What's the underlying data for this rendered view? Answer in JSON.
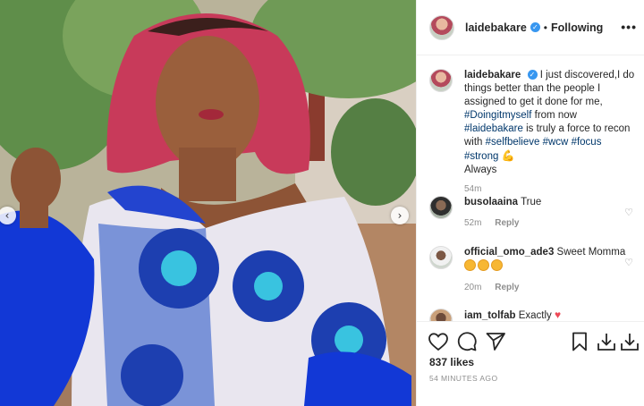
{
  "post": {
    "username": "laidebakare",
    "follow_status": "Following",
    "separator": "•",
    "more_label": "•••",
    "likes": "837 likes",
    "posted_ago": "54 MINUTES AGO"
  },
  "caption": {
    "username": "laidebakare",
    "text_1": "I just discovered,I do things better than the people I assigned to get it done for me,",
    "tag_1": "#Doingitmyself",
    "text_2": "from now",
    "tag_2": "#laidebakare",
    "text_3": "is truly a force to recon with",
    "tag_3": "#selfbelieve",
    "tag_4": "#wcw",
    "tag_5": "#focus",
    "tag_6": "#strong",
    "text_4": "Always",
    "time": "54m"
  },
  "comments": [
    {
      "username": "busolaaina",
      "text": "True",
      "time": "52m",
      "reply": "Reply"
    },
    {
      "username": "official_omo_ade3",
      "text": "Sweet Momma",
      "time": "20m",
      "reply": "Reply"
    },
    {
      "username": "iam_tolfab",
      "text": "Exactly"
    }
  ],
  "icons": {
    "like": "heart-icon",
    "comment": "comment-icon",
    "share": "share-icon",
    "save": "bookmark-icon",
    "download": "download-icon",
    "nav_prev": "chevron-left-icon",
    "nav_next": "chevron-right-icon"
  },
  "colors": {
    "link": "#00376b",
    "verified": "#3897f0",
    "muted": "#8e8e8e",
    "heart_red": "#ed4956"
  }
}
